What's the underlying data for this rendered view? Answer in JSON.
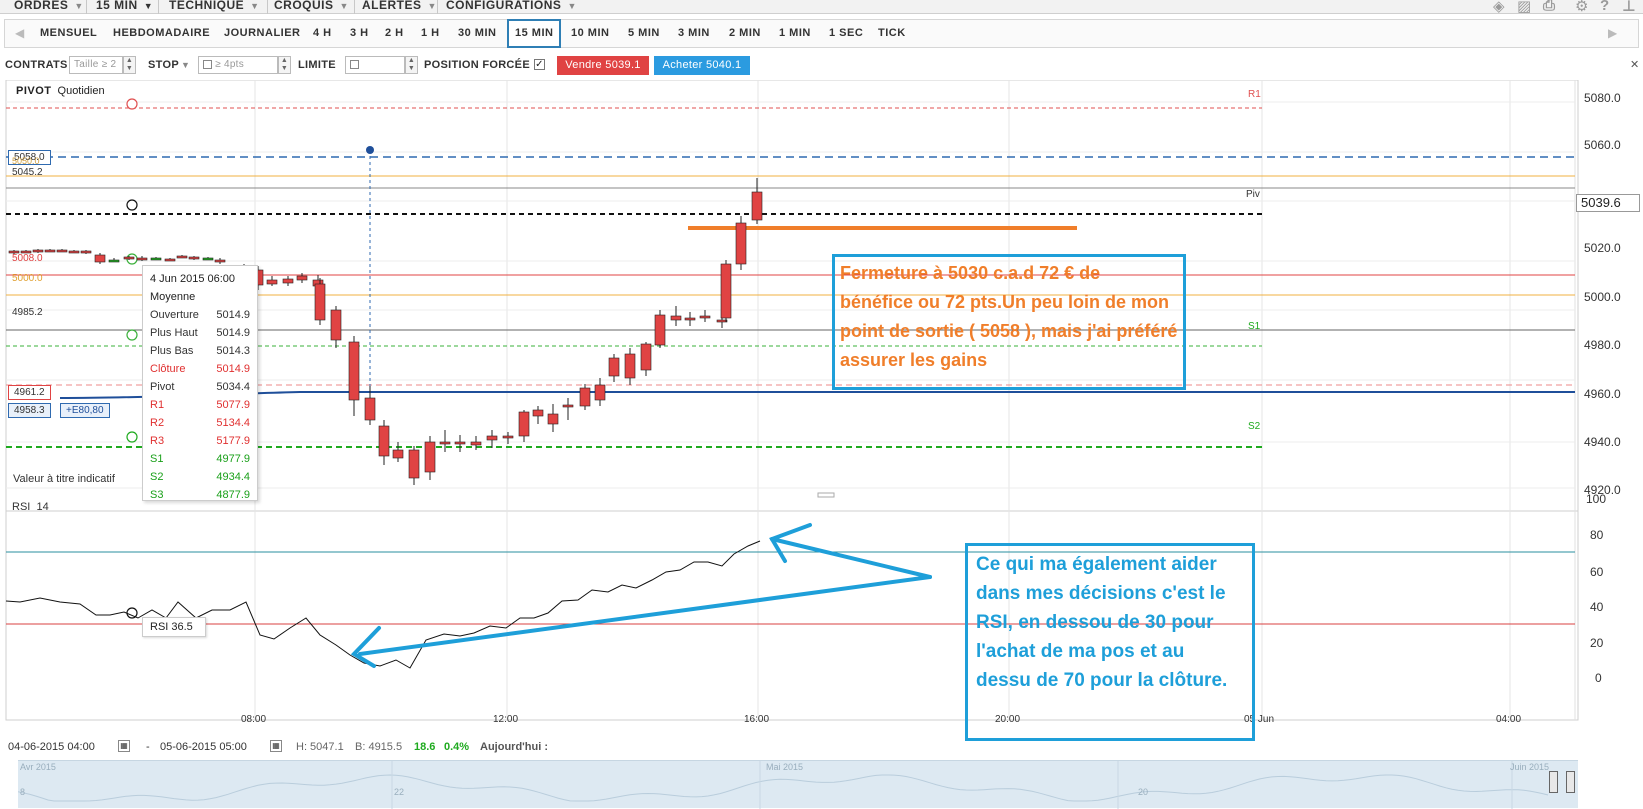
{
  "top_menu": {
    "items": [
      "ORDRES",
      "15 MIN",
      "TECHNIQUE",
      "CROQUIS",
      "ALERTES",
      "CONFIGURATIONS"
    ]
  },
  "timeframes": {
    "items": [
      "MENSUEL",
      "HEBDOMADAIRE",
      "JOURNALIER",
      "4 H",
      "3 H",
      "2 H",
      "1 H",
      "30 MIN",
      "15 MIN",
      "10 MIN",
      "5 MIN",
      "3 MIN",
      "2 MIN",
      "1 MIN",
      "1 SEC",
      "TICK"
    ],
    "active": "15 MIN"
  },
  "order_bar": {
    "contracts_label": "CONTRATS",
    "size_placeholder": "Taille ≥ 2",
    "stop_label": "STOP",
    "stop_placeholder": "≥ 4pts",
    "limit_label": "LIMITE",
    "forced_position_label": "POSITION FORCÉE",
    "sell_button": "Vendre 5039.1",
    "buy_button": "Acheter 5040.1",
    "forced_position_checked": true
  },
  "price_panel": {
    "title": "PIVOT",
    "subtitle": "Quotidien",
    "indicative_note": "Valeur à titre indicatif",
    "axis_labels": [
      "5080.0",
      "5060.0",
      "5039.6",
      "5020.0",
      "5000.0",
      "4980.0",
      "4960.0",
      "4940.0",
      "4920.0"
    ],
    "left_labels": {
      "l5058": "5058.0",
      "l5050": "5050.0",
      "l5045": "5045.2",
      "l5008": "5008.0",
      "l5000": "5000.0",
      "l4985": "4985.2",
      "l4961": "4961.2",
      "l4958": "4958.3",
      "e_tag": "+E80,80"
    },
    "level_tags": {
      "r1": "R1",
      "piv": "Piv",
      "s1": "S1",
      "s2": "S2"
    },
    "current_price": "5039.6"
  },
  "tooltip": {
    "date": "4 Jun 2015 06:00",
    "kind": "Moyenne",
    "rows": [
      {
        "label": "Ouverture",
        "value": "5014.9",
        "color": "#333333"
      },
      {
        "label": "Plus Haut",
        "value": "5014.9",
        "color": "#333333"
      },
      {
        "label": "Plus Bas",
        "value": "5014.3",
        "color": "#333333"
      },
      {
        "label": "Clôture",
        "value": "5014.9",
        "color": "#e03030"
      },
      {
        "label": "Pivot",
        "value": "5034.4",
        "color": "#333333"
      },
      {
        "label": "R1",
        "value": "5077.9",
        "color": "#e03030"
      },
      {
        "label": "R2",
        "value": "5134.4",
        "color": "#e03030"
      },
      {
        "label": "R3",
        "value": "5177.9",
        "color": "#e03030"
      },
      {
        "label": "S1",
        "value": "4977.9",
        "color": "#1aa01a"
      },
      {
        "label": "S2",
        "value": "4934.4",
        "color": "#1aa01a"
      },
      {
        "label": "S3",
        "value": "4877.9",
        "color": "#1aa01a"
      }
    ]
  },
  "rsi_panel": {
    "title": "RSI",
    "period": "14",
    "tooltip": "RSI  36.5",
    "axis_labels": [
      "100",
      "80",
      "60",
      "40",
      "20",
      "0"
    ]
  },
  "time_axis": [
    "08:00",
    "12:00",
    "16:00",
    "20:00",
    "05 Jun",
    "04:00"
  ],
  "annotations": {
    "close_note": "Fermeture à 5030 c.a.d 72 € de bénéfice ou 72 pts.Un peu loin de mon point de sortie ( 5058 ), mais j'ai préféré assurer les gains",
    "rsi_note": "Ce qui ma également aider dans mes décisions c'est le RSI, en dessou de 30 pour l'achat de ma pos et au dessu de 70 pour la clôture."
  },
  "bottom_bar": {
    "from": "04-06-2015 04:00",
    "dash": "-",
    "to": "05-06-2015 05:00",
    "high": "H: 5047.1",
    "low": "B: 4915.5",
    "change": "18.6",
    "change_pct": "0.4%",
    "today": "Aujourd'hui :"
  },
  "navigator": {
    "labels": [
      "Avr 2015",
      "Mai 2015",
      "Juin 2015",
      "8",
      "22",
      "20"
    ]
  },
  "colors": {
    "up_candle": "#22aa22",
    "down_candle": "#e04343",
    "accent_blue": "#1e9fd9",
    "annotation_orange": "#f07e2a"
  }
}
